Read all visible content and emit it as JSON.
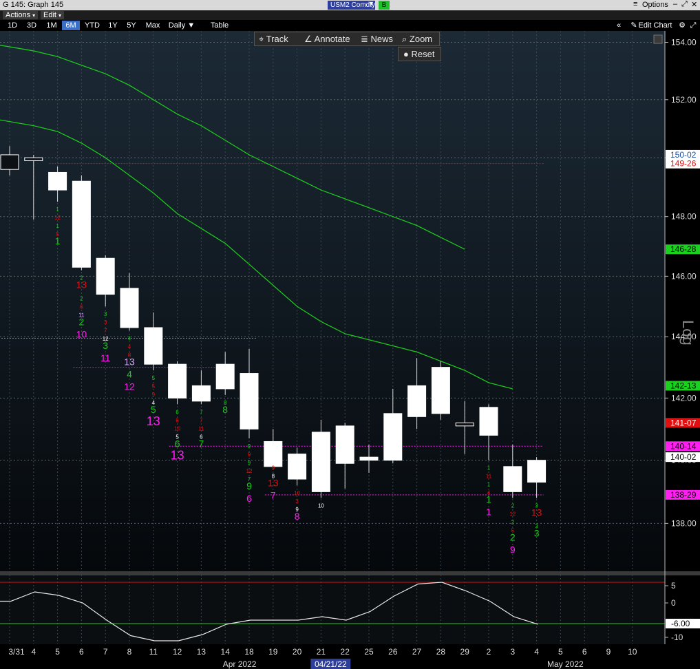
{
  "window": {
    "title": "G 145: Graph 145",
    "ticker": "USM2 Comdty",
    "ticker_badge": "B",
    "options_label": "Options"
  },
  "menu": {
    "actions": "Actions",
    "edit": "Edit"
  },
  "ranges": [
    "1D",
    "3D",
    "1M",
    "6M",
    "YTD",
    "1Y",
    "5Y",
    "Max"
  ],
  "selected_range": "6M",
  "frequency": "Daily",
  "table_label": "Table",
  "edit_chart_label": "Edit Chart",
  "toolbar": {
    "track": "Track",
    "annotate": "Annotate",
    "news": "News",
    "zoom": "Zoom",
    "reset": "Reset"
  },
  "colors": {
    "background": "#000000",
    "candle": "#ffffff",
    "ma": "#1ec81e",
    "up_arrow": "#1ec81e",
    "down_arrow": "#e01010"
  },
  "chart_data": [
    {
      "type": "candlestick",
      "scale": "log",
      "ylim": [
        136.5,
        154.4
      ],
      "yticks": [
        "138.00",
        "140.00",
        "142.00",
        "144.00",
        "146.00",
        "148.00",
        "150.00",
        "152.00",
        "154.00"
      ],
      "y_axis_title": "Log",
      "x_labels": [
        "3/31",
        "4",
        "5",
        "6",
        "7",
        "8",
        "11",
        "12",
        "13",
        "14",
        "18",
        "19",
        "20",
        "21",
        "22",
        "25",
        "26",
        "27",
        "28",
        "29",
        "2",
        "3",
        "4",
        "5",
        "6",
        "9",
        "10"
      ],
      "month_labels": [
        "Apr 2022",
        "May 2022"
      ],
      "cursor_date": "04/21/22",
      "candles": [
        {
          "o": 149.6,
          "h": 150.4,
          "l": 149.4,
          "c": 150.1
        },
        {
          "o": 149.9,
          "h": 150.1,
          "l": 147.9,
          "c": 150.0
        },
        {
          "o": 149.5,
          "h": 149.7,
          "l": 148.5,
          "c": 148.9
        },
        {
          "o": 149.2,
          "h": 149.4,
          "l": 146.2,
          "c": 146.3
        },
        {
          "o": 146.6,
          "h": 146.7,
          "l": 145.0,
          "c": 145.4
        },
        {
          "o": 145.6,
          "h": 146.1,
          "l": 144.2,
          "c": 144.3
        },
        {
          "o": 144.3,
          "h": 144.8,
          "l": 142.9,
          "c": 143.1
        },
        {
          "o": 143.1,
          "h": 143.2,
          "l": 141.8,
          "c": 142.0
        },
        {
          "o": 142.4,
          "h": 142.9,
          "l": 141.8,
          "c": 141.9
        },
        {
          "o": 143.1,
          "h": 143.5,
          "l": 142.1,
          "c": 142.3
        },
        {
          "o": 142.8,
          "h": 143.6,
          "l": 140.7,
          "c": 141.0
        },
        {
          "o": 140.6,
          "h": 141.0,
          "l": 140.0,
          "c": 139.8
        },
        {
          "o": 140.2,
          "h": 140.4,
          "l": 139.2,
          "c": 139.4
        },
        {
          "o": 140.9,
          "h": 141.3,
          "l": 138.8,
          "c": 139.0
        },
        {
          "o": 141.1,
          "h": 141.2,
          "l": 139.1,
          "c": 139.9
        },
        {
          "o": 140.1,
          "h": 140.5,
          "l": 139.6,
          "c": 140.0
        },
        {
          "o": 141.5,
          "h": 142.3,
          "l": 139.9,
          "c": 140.0
        },
        {
          "o": 142.4,
          "h": 143.3,
          "l": 141.0,
          "c": 141.4
        },
        {
          "o": 143.0,
          "h": 143.2,
          "l": 141.3,
          "c": 141.5
        },
        {
          "o": 141.1,
          "h": 141.9,
          "l": 140.2,
          "c": 141.2
        },
        {
          "o": 141.7,
          "h": 141.8,
          "l": 140.0,
          "c": 140.8
        },
        {
          "o": 139.8,
          "h": 140.5,
          "l": 138.8,
          "c": 139.0
        },
        {
          "o": 140.0,
          "h": 140.1,
          "l": 138.8,
          "c": 139.3
        }
      ],
      "moving_averages": [
        {
          "values": [
            153.9,
            153.7,
            153.5,
            153.2,
            152.9,
            152.5,
            152.0,
            151.5,
            151.1,
            150.6,
            150.1,
            149.7,
            149.3,
            148.9,
            148.6,
            148.3,
            148.0,
            147.7,
            147.3,
            146.9
          ]
        },
        {
          "values": [
            151.3,
            151.1,
            150.9,
            150.5,
            150.0,
            149.4,
            148.8,
            148.1,
            147.6,
            147.1,
            146.4,
            145.7,
            145.0,
            144.5,
            144.1,
            143.9,
            143.7,
            143.5,
            143.2,
            142.9,
            142.5,
            142.3
          ]
        }
      ],
      "price_tags": [
        {
          "label": "150-02",
          "value": 150.1,
          "bg": "#ffffff",
          "fg": "#1a4fa8"
        },
        {
          "label": "149-26",
          "value": 149.8,
          "bg": "#ffffff",
          "fg": "#e01010"
        },
        {
          "label": "146-28",
          "value": 146.9,
          "bg": "#19d11e",
          "fg": "#000000"
        },
        {
          "label": "142-13",
          "value": 142.4,
          "bg": "#19d11e",
          "fg": "#000000"
        },
        {
          "label": "141-07",
          "value": 141.2,
          "bg": "#e01010",
          "fg": "#ffffff"
        },
        {
          "label": "140-14",
          "value": 140.45,
          "bg": "#ff1ff0",
          "fg": "#000000"
        },
        {
          "label": "140-02",
          "value": 140.1,
          "bg": "#ffffff",
          "fg": "#000000"
        },
        {
          "label": "138-29",
          "value": 138.9,
          "bg": "#ff1ff0",
          "fg": "#000000"
        }
      ],
      "td_counts": [
        {
          "i": 2,
          "labels": [
            {
              "t": "1",
              "c": "#1ec81e"
            },
            {
              "t": "12",
              "c": "#e01010"
            },
            {
              "t": "1",
              "c": "#1ec81e"
            },
            {
              "t": "5",
              "c": "#e01010"
            },
            {
              "t": "1",
              "c": "#1ec81e",
              "big": 1
            }
          ]
        },
        {
          "i": 3,
          "labels": [
            {
              "t": "2",
              "c": "#1ec81e"
            },
            {
              "t": "13",
              "c": "#e01010",
              "big": 1
            },
            {
              "t": "2",
              "c": "#1ec81e"
            },
            {
              "t": "6",
              "c": "#e01010"
            },
            {
              "t": "11",
              "c": "#d8a8ff"
            },
            {
              "t": "2",
              "c": "#1ec81e",
              "big": 1
            },
            {
              "t": "10",
              "c": "#ff1ff0",
              "big": 1
            }
          ]
        },
        {
          "i": 4,
          "labels": [
            {
              "t": "3",
              "c": "#1ec81e"
            },
            {
              "t": "3",
              "c": "#e01010"
            },
            {
              "t": "7",
              "c": "#e01010"
            },
            {
              "t": "12",
              "c": "#ffffff"
            },
            {
              "t": "3",
              "c": "#1ec81e",
              "big": 1
            },
            {
              "t": "11",
              "c": "#ff1ff0",
              "big": 1
            }
          ]
        },
        {
          "i": 5,
          "labels": [
            {
              "t": "4",
              "c": "#1ec81e"
            },
            {
              "t": "4",
              "c": "#e01010"
            },
            {
              "t": "8",
              "c": "#e01010"
            },
            {
              "t": "13",
              "c": "#d8a8ff",
              "big": 1
            },
            {
              "t": "4",
              "c": "#1ec81e",
              "big": 1
            },
            {
              "t": "12",
              "c": "#ff1ff0",
              "big": 1
            }
          ]
        },
        {
          "i": 6,
          "labels": [
            {
              "t": "5",
              "c": "#1ec81e"
            },
            {
              "t": "5",
              "c": "#e01010"
            },
            {
              "t": "9",
              "c": "#e01010"
            },
            {
              "t": "4",
              "c": "#ffffff"
            },
            {
              "t": "5",
              "c": "#1ec81e",
              "big": 1
            },
            {
              "t": "13",
              "c": "#ff1ff0",
              "huge": 1
            }
          ]
        },
        {
          "i": 7,
          "labels": [
            {
              "t": "6",
              "c": "#1ec81e"
            },
            {
              "t": "6",
              "c": "#e01010"
            },
            {
              "t": "10",
              "c": "#e01010"
            },
            {
              "t": "5",
              "c": "#ffffff"
            },
            {
              "t": "6",
              "c": "#1ec81e",
              "big": 1
            },
            {
              "t": "13",
              "c": "#ff1ff0",
              "huge": 1
            }
          ]
        },
        {
          "i": 8,
          "labels": [
            {
              "t": "7",
              "c": "#1ec81e"
            },
            {
              "t": "7",
              "c": "#e01010"
            },
            {
              "t": "11",
              "c": "#e01010"
            },
            {
              "t": "6",
              "c": "#ffffff"
            },
            {
              "t": "7",
              "c": "#1ec81e",
              "big": 1
            }
          ]
        },
        {
          "i": 9,
          "labels": [
            {
              "t": "8",
              "c": "#1ec81e"
            },
            {
              "t": "8",
              "c": "#1ec81e",
              "big": 1
            }
          ]
        },
        {
          "i": 10,
          "labels": [
            {
              "t": "9",
              "c": "#1ec81e"
            },
            {
              "t": "9",
              "c": "#e01010"
            },
            {
              "t": "9",
              "c": "#1ec81e"
            },
            {
              "t": "12",
              "c": "#e01010"
            },
            {
              "t": "7",
              "c": "#1ec81e"
            },
            {
              "t": "9",
              "c": "#1ec81e",
              "big": 1
            },
            {
              "t": "6",
              "c": "#ff1ff0",
              "big": 1
            }
          ]
        },
        {
          "i": 11,
          "labels": [
            {
              "t": "9",
              "c": "#e01010"
            },
            {
              "t": "8",
              "c": "#ffffff"
            },
            {
              "t": "13",
              "c": "#e01010",
              "big": 1
            },
            {
              "t": "7",
              "c": "#ff1ff0",
              "big": 1
            }
          ]
        },
        {
          "i": 12,
          "labels": [
            {
              "t": "10",
              "c": "#e01010"
            },
            {
              "t": "3",
              "c": "#e01010"
            },
            {
              "t": "9",
              "c": "#ffffff"
            },
            {
              "t": "8",
              "c": "#ff1ff0",
              "big": 1
            }
          ]
        },
        {
          "i": 13,
          "labels": [
            {
              "t": "10",
              "c": "#ffffff"
            }
          ]
        },
        {
          "i": 20,
          "labels": [
            {
              "t": "1",
              "c": "#1ec81e"
            },
            {
              "t": "11",
              "c": "#e01010"
            },
            {
              "t": "1",
              "c": "#1ec81e"
            },
            {
              "t": "4",
              "c": "#e01010"
            },
            {
              "t": "1",
              "c": "#1ec81e",
              "big": 1
            },
            {
              "t": "1",
              "c": "#ff1ff0",
              "big": 1
            }
          ]
        },
        {
          "i": 21,
          "labels": [
            {
              "t": "2",
              "c": "#1ec81e"
            },
            {
              "t": "12",
              "c": "#e01010"
            },
            {
              "t": "2",
              "c": "#1ec81e"
            },
            {
              "t": "5",
              "c": "#e01010"
            },
            {
              "t": "2",
              "c": "#1ec81e",
              "big": 1
            },
            {
              "t": "9",
              "c": "#ff1ff0",
              "big": 1
            }
          ]
        },
        {
          "i": 22,
          "labels": [
            {
              "t": "3",
              "c": "#1ec81e"
            },
            {
              "t": "13",
              "c": "#e01010",
              "big": 1
            },
            {
              "t": "3",
              "c": "#1ec81e"
            },
            {
              "t": "3",
              "c": "#1ec81e",
              "big": 1
            }
          ]
        }
      ],
      "ref_lines": [
        {
          "value": 149.8,
          "color": "#e01010",
          "from": 2,
          "to": 22
        },
        {
          "value": 143.95,
          "color": "#ff1ff0",
          "from": 0,
          "to": 10
        },
        {
          "value": 143.0,
          "color": "#b52ad4",
          "from": 3,
          "to": 9
        },
        {
          "value": 140.45,
          "color": "#ff1ff0",
          "from": 7,
          "to": 22
        },
        {
          "value": 138.9,
          "color": "#ff1ff0",
          "from": 11,
          "to": 22
        }
      ]
    },
    {
      "type": "line",
      "name": "oscillator",
      "ylim": [
        -12,
        8
      ],
      "yticks": [
        "5",
        "0",
        "-10"
      ],
      "current_label": "-6.00",
      "levels": [
        6,
        -6
      ],
      "values": [
        0.5,
        3.2,
        2.2,
        0.0,
        -5.0,
        -9.5,
        -11.0,
        -11.0,
        -9.2,
        -6.2,
        -5.0,
        -5.0,
        -5.0,
        -4.0,
        -5.0,
        -2.5,
        2.0,
        5.5,
        6.0,
        3.5,
        0.5,
        -4.0,
        -6.2
      ]
    }
  ]
}
